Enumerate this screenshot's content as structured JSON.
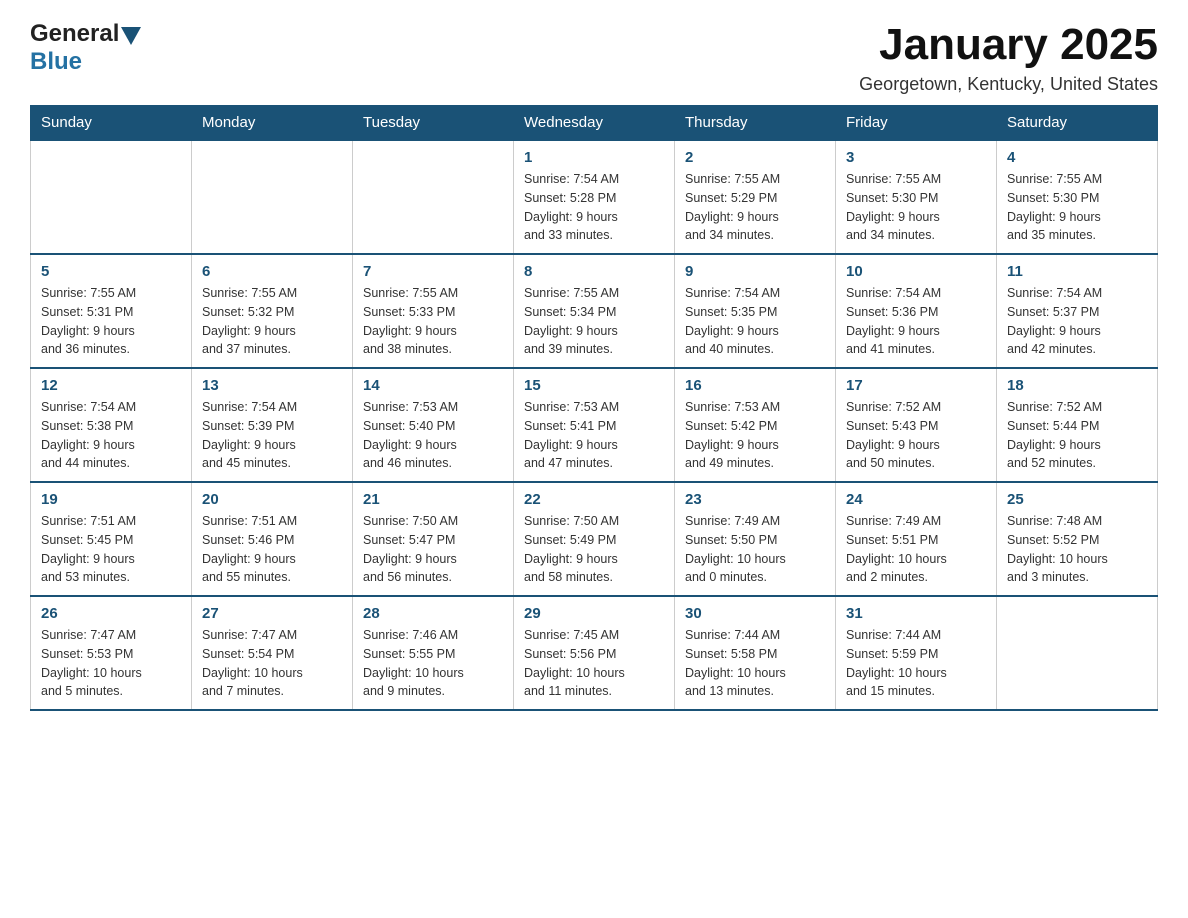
{
  "header": {
    "logo_general": "General",
    "logo_blue": "Blue",
    "month": "January 2025",
    "location": "Georgetown, Kentucky, United States"
  },
  "days_of_week": [
    "Sunday",
    "Monday",
    "Tuesday",
    "Wednesday",
    "Thursday",
    "Friday",
    "Saturday"
  ],
  "weeks": [
    [
      {
        "day": "",
        "info": ""
      },
      {
        "day": "",
        "info": ""
      },
      {
        "day": "",
        "info": ""
      },
      {
        "day": "1",
        "info": "Sunrise: 7:54 AM\nSunset: 5:28 PM\nDaylight: 9 hours\nand 33 minutes."
      },
      {
        "day": "2",
        "info": "Sunrise: 7:55 AM\nSunset: 5:29 PM\nDaylight: 9 hours\nand 34 minutes."
      },
      {
        "day": "3",
        "info": "Sunrise: 7:55 AM\nSunset: 5:30 PM\nDaylight: 9 hours\nand 34 minutes."
      },
      {
        "day": "4",
        "info": "Sunrise: 7:55 AM\nSunset: 5:30 PM\nDaylight: 9 hours\nand 35 minutes."
      }
    ],
    [
      {
        "day": "5",
        "info": "Sunrise: 7:55 AM\nSunset: 5:31 PM\nDaylight: 9 hours\nand 36 minutes."
      },
      {
        "day": "6",
        "info": "Sunrise: 7:55 AM\nSunset: 5:32 PM\nDaylight: 9 hours\nand 37 minutes."
      },
      {
        "day": "7",
        "info": "Sunrise: 7:55 AM\nSunset: 5:33 PM\nDaylight: 9 hours\nand 38 minutes."
      },
      {
        "day": "8",
        "info": "Sunrise: 7:55 AM\nSunset: 5:34 PM\nDaylight: 9 hours\nand 39 minutes."
      },
      {
        "day": "9",
        "info": "Sunrise: 7:54 AM\nSunset: 5:35 PM\nDaylight: 9 hours\nand 40 minutes."
      },
      {
        "day": "10",
        "info": "Sunrise: 7:54 AM\nSunset: 5:36 PM\nDaylight: 9 hours\nand 41 minutes."
      },
      {
        "day": "11",
        "info": "Sunrise: 7:54 AM\nSunset: 5:37 PM\nDaylight: 9 hours\nand 42 minutes."
      }
    ],
    [
      {
        "day": "12",
        "info": "Sunrise: 7:54 AM\nSunset: 5:38 PM\nDaylight: 9 hours\nand 44 minutes."
      },
      {
        "day": "13",
        "info": "Sunrise: 7:54 AM\nSunset: 5:39 PM\nDaylight: 9 hours\nand 45 minutes."
      },
      {
        "day": "14",
        "info": "Sunrise: 7:53 AM\nSunset: 5:40 PM\nDaylight: 9 hours\nand 46 minutes."
      },
      {
        "day": "15",
        "info": "Sunrise: 7:53 AM\nSunset: 5:41 PM\nDaylight: 9 hours\nand 47 minutes."
      },
      {
        "day": "16",
        "info": "Sunrise: 7:53 AM\nSunset: 5:42 PM\nDaylight: 9 hours\nand 49 minutes."
      },
      {
        "day": "17",
        "info": "Sunrise: 7:52 AM\nSunset: 5:43 PM\nDaylight: 9 hours\nand 50 minutes."
      },
      {
        "day": "18",
        "info": "Sunrise: 7:52 AM\nSunset: 5:44 PM\nDaylight: 9 hours\nand 52 minutes."
      }
    ],
    [
      {
        "day": "19",
        "info": "Sunrise: 7:51 AM\nSunset: 5:45 PM\nDaylight: 9 hours\nand 53 minutes."
      },
      {
        "day": "20",
        "info": "Sunrise: 7:51 AM\nSunset: 5:46 PM\nDaylight: 9 hours\nand 55 minutes."
      },
      {
        "day": "21",
        "info": "Sunrise: 7:50 AM\nSunset: 5:47 PM\nDaylight: 9 hours\nand 56 minutes."
      },
      {
        "day": "22",
        "info": "Sunrise: 7:50 AM\nSunset: 5:49 PM\nDaylight: 9 hours\nand 58 minutes."
      },
      {
        "day": "23",
        "info": "Sunrise: 7:49 AM\nSunset: 5:50 PM\nDaylight: 10 hours\nand 0 minutes."
      },
      {
        "day": "24",
        "info": "Sunrise: 7:49 AM\nSunset: 5:51 PM\nDaylight: 10 hours\nand 2 minutes."
      },
      {
        "day": "25",
        "info": "Sunrise: 7:48 AM\nSunset: 5:52 PM\nDaylight: 10 hours\nand 3 minutes."
      }
    ],
    [
      {
        "day": "26",
        "info": "Sunrise: 7:47 AM\nSunset: 5:53 PM\nDaylight: 10 hours\nand 5 minutes."
      },
      {
        "day": "27",
        "info": "Sunrise: 7:47 AM\nSunset: 5:54 PM\nDaylight: 10 hours\nand 7 minutes."
      },
      {
        "day": "28",
        "info": "Sunrise: 7:46 AM\nSunset: 5:55 PM\nDaylight: 10 hours\nand 9 minutes."
      },
      {
        "day": "29",
        "info": "Sunrise: 7:45 AM\nSunset: 5:56 PM\nDaylight: 10 hours\nand 11 minutes."
      },
      {
        "day": "30",
        "info": "Sunrise: 7:44 AM\nSunset: 5:58 PM\nDaylight: 10 hours\nand 13 minutes."
      },
      {
        "day": "31",
        "info": "Sunrise: 7:44 AM\nSunset: 5:59 PM\nDaylight: 10 hours\nand 15 minutes."
      },
      {
        "day": "",
        "info": ""
      }
    ]
  ]
}
